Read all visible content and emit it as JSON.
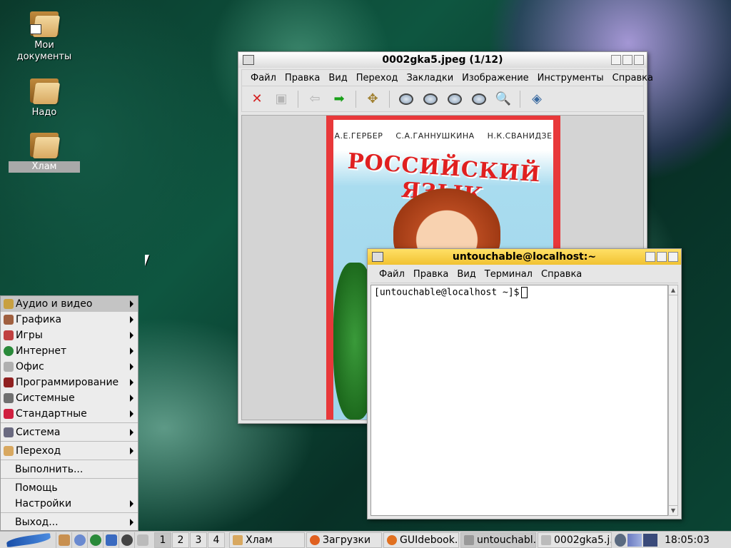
{
  "desktop": {
    "icons": [
      {
        "label_line1": "Мои",
        "label_line2": "документы"
      },
      {
        "label_line1": "Надо"
      },
      {
        "label_line1": "Хлам"
      }
    ]
  },
  "viewer": {
    "title": "0002gka5.jpeg  (1/12)",
    "menu": [
      "Файл",
      "Правка",
      "Вид",
      "Переход",
      "Закладки",
      "Изображение",
      "Инструменты",
      "Справка"
    ],
    "book": {
      "authors": "А.Е.ГЕРБЕР С.А.ГАННУШКИНА Н.К.СВАНИДЗЕ",
      "title": "РОССИЙСКИЙ ЯЗЫК"
    }
  },
  "terminal": {
    "title": "untouchable@localhost:~",
    "menu": [
      "Файл",
      "Правка",
      "Вид",
      "Терминал",
      "Справка"
    ],
    "prompt": "[untouchable@localhost ~]$"
  },
  "start_menu": {
    "items": [
      {
        "label": "Аудио и видео",
        "color": "#c8a040"
      },
      {
        "label": "Графика",
        "color": "#a06040"
      },
      {
        "label": "Игры",
        "color": "#c04040"
      },
      {
        "label": "Интернет",
        "color": "#2a8a3a"
      },
      {
        "label": "Офис",
        "color": "#b0b0b0"
      },
      {
        "label": "Программирование",
        "color": "#902020"
      },
      {
        "label": "Системные",
        "color": "#707070"
      },
      {
        "label": "Стандартные",
        "color": "#d02040"
      }
    ],
    "system": "Система",
    "goto": "Переход",
    "run": "Выполнить...",
    "help": "Помощь",
    "settings": "Настройки",
    "exit": "Выход..."
  },
  "taskbar": {
    "desktops": [
      "1",
      "2",
      "3",
      "4"
    ],
    "tasks": [
      {
        "label": "Хлам",
        "color": "#d8a860"
      },
      {
        "label": "Загрузки",
        "color": "#e06020"
      },
      {
        "label": "GUIdebook...",
        "color": "#e07020"
      },
      {
        "label": "untouchabl...",
        "color": "#999999"
      },
      {
        "label": "0002gka5.j...",
        "color": "#bbbbbb"
      }
    ],
    "clock": "18:05:03"
  }
}
